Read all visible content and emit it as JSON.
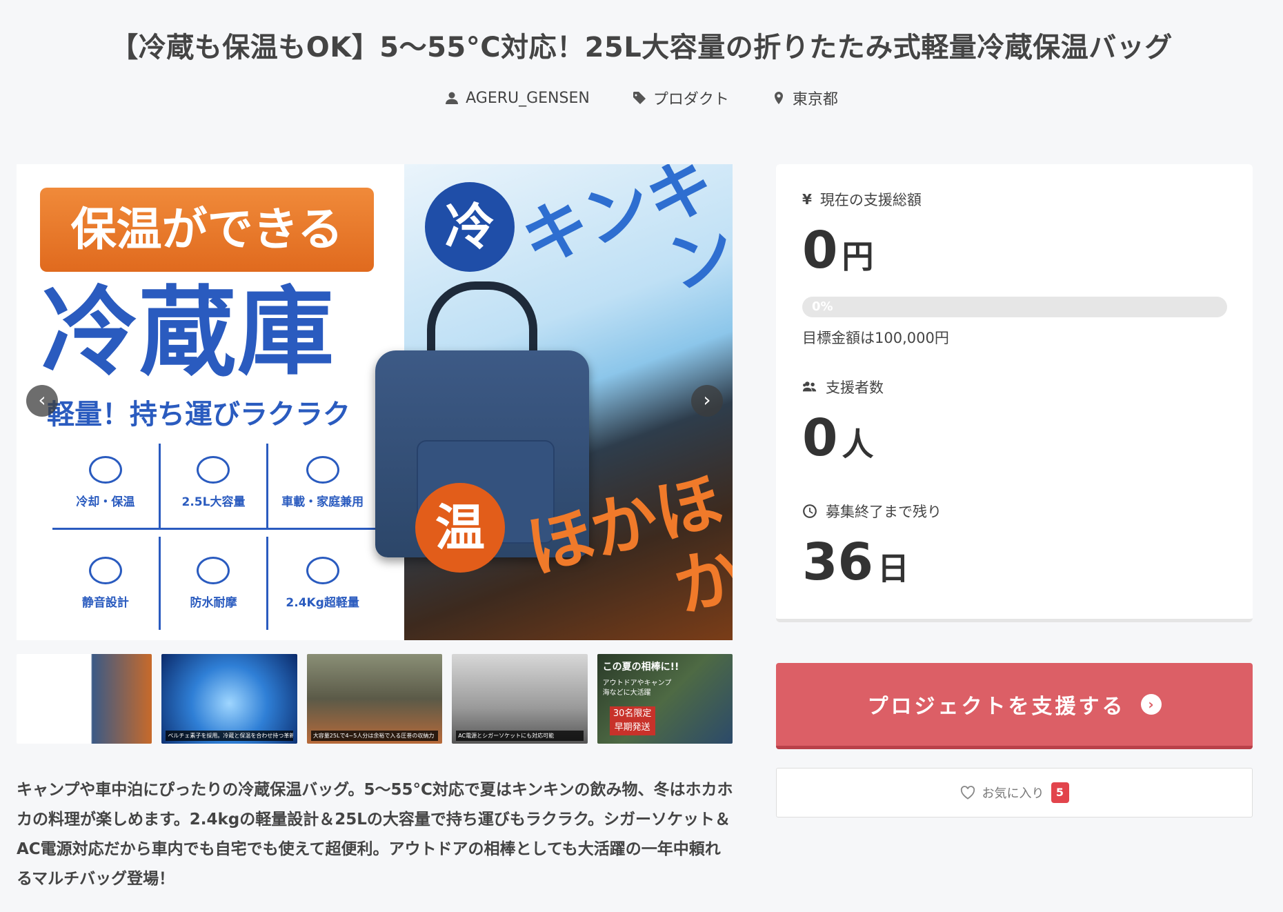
{
  "project": {
    "title": "【冷蔵も保温もOK】5〜55°C対応！25L大容量の折りたたみ式軽量冷蔵保温バッグ",
    "owner": "AGERU_GENSEN",
    "category": "プロダクト",
    "location": "東京都"
  },
  "hero": {
    "banner": "保温ができる",
    "headline": "冷蔵庫",
    "subline": "軽量！持ち運びラクラク",
    "features": [
      "冷却・保温",
      "2.5L大容量",
      "車載・家庭兼用",
      "静音設計",
      "防水耐摩",
      "2.4Kg超軽量"
    ],
    "cold_badge": "冷",
    "cold_text": "キンキン",
    "hot_badge": "温",
    "hot_text": "ほかほか",
    "prev": "‹",
    "next": "›"
  },
  "thumbnails": [
    {
      "title": "",
      "caption": ""
    },
    {
      "title": "",
      "caption": "ペルチェ素子を採用。冷蔵と保温を合わせ持つ革新的バッグ"
    },
    {
      "title": "",
      "caption": "大容量25Lで4~5人分は余裕で入る圧巻の収納力"
    },
    {
      "title": "",
      "caption": "AC電源とシガーソケットにも対応可能"
    },
    {
      "title": "この夏の相棒に!!",
      "sub": "アウトドアやキャンプ 海などに大活躍",
      "badge_line1": "30名限定",
      "badge_line2": "早期発送"
    }
  ],
  "description": "キャンプや車中泊にぴったりの冷蔵保温バッグ。5〜55°C対応で夏はキンキンの飲み物、冬はホカホカの料理が楽しめます。2.4kgの軽量設計＆25Lの大容量で持ち運びもラクラク。シガーソケット＆AC電源対応だから車内でも自宅でも使えて超便利。アウトドアの相棒としても大活躍の一年中頼れるマルチバッグ登場！",
  "stats": {
    "amount_label": "現在の支援総額",
    "amount_value": "0",
    "amount_unit": "円",
    "progress_text": "0%",
    "progress_fraction": 0,
    "goal": "目標金額は100,000円",
    "backers_label": "支援者数",
    "backers_value": "0",
    "backers_unit": "人",
    "remaining_label": "募集終了まで残り",
    "remaining_value": "36",
    "remaining_unit": "日"
  },
  "actions": {
    "support": "プロジェクトを支援する",
    "favorite": "お気に入り",
    "favorite_count": "5"
  },
  "colors": {
    "accent": "#dc5f66",
    "badge": "#e2444c"
  }
}
